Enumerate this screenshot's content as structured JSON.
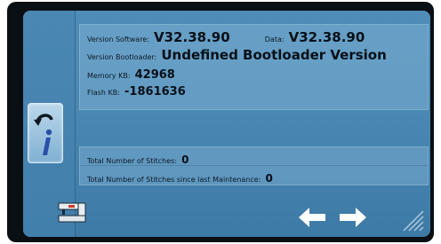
{
  "version_software": {
    "label": "Version Software:",
    "value": "V32.38.90"
  },
  "data": {
    "label": "Data:",
    "value": "V32.38.90"
  },
  "version_bootloader": {
    "label": "Version Bootloader:",
    "value": "Undefined Bootloader Version"
  },
  "memory": {
    "label": "Memory KB:",
    "value": "42968"
  },
  "flash": {
    "label": "Flash KB:",
    "value": "-1861636"
  },
  "stitches_total": {
    "label": "Total Number of Stitches:",
    "value": "0"
  },
  "stitches_maintenance": {
    "label": "Total Number of Stitches since last Maintenance:",
    "value": "0"
  },
  "icons": {
    "info": "info-icon",
    "machine": "sewing-machine-icon",
    "back": "arrow-left-icon",
    "forward": "arrow-right-icon",
    "grip": "resize-grip-icon"
  },
  "colors": {
    "screen_blue": "#4a87b2",
    "panel": "#96c3e1",
    "bezel": "#0a0f14"
  }
}
